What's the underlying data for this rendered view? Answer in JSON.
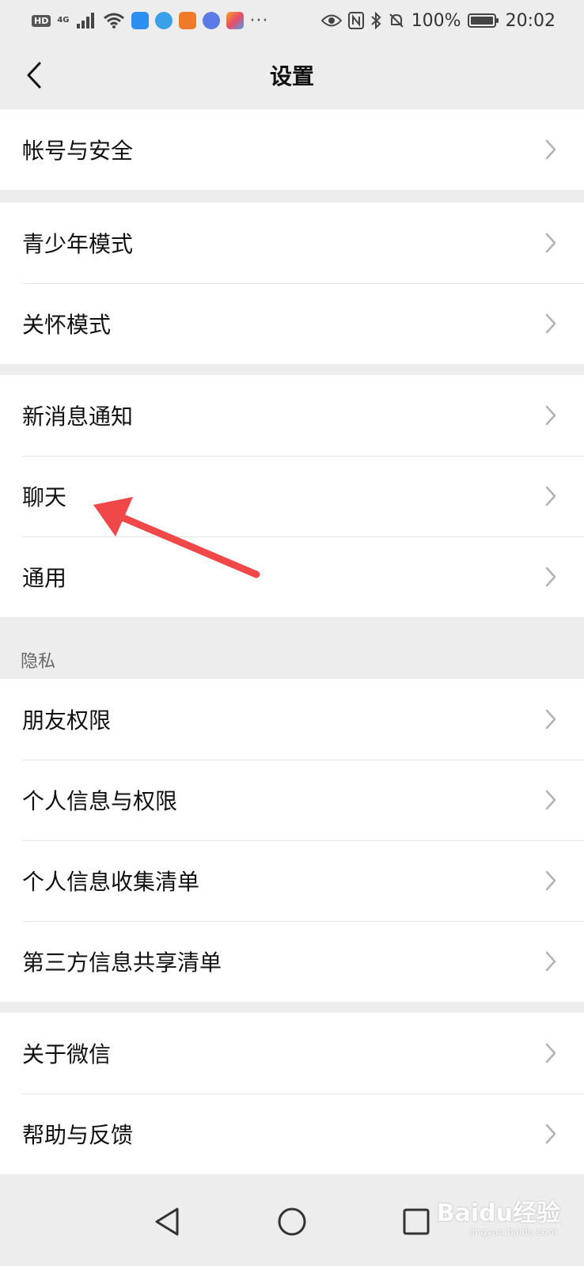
{
  "status_bar": {
    "hd": "HD",
    "network": "4G",
    "more": "···",
    "battery": "100%",
    "time": "20:02"
  },
  "nav": {
    "title": "设置"
  },
  "groups": [
    {
      "items": [
        "帐号与安全"
      ]
    },
    {
      "items": [
        "青少年模式",
        "关怀模式"
      ]
    },
    {
      "items": [
        "新消息通知",
        "聊天",
        "通用"
      ]
    },
    {
      "header": "隐私",
      "items": [
        "朋友权限",
        "个人信息与权限",
        "个人信息收集清单",
        "第三方信息共享清单"
      ]
    },
    {
      "items": [
        "关于微信",
        "帮助与反馈"
      ]
    }
  ],
  "icons": {
    "back": "chevron-left-icon",
    "row_arrow": "chevron-right-icon",
    "sys_back": "triangle-back-icon",
    "sys_home": "circle-home-icon",
    "sys_recent": "square-recent-icon"
  },
  "colors": {
    "background": "#ededed",
    "card": "#ffffff",
    "annotation_arrow": "#f04848"
  },
  "watermark": {
    "logo": "Baidu经验",
    "url": "jingyan.baidu.com"
  }
}
